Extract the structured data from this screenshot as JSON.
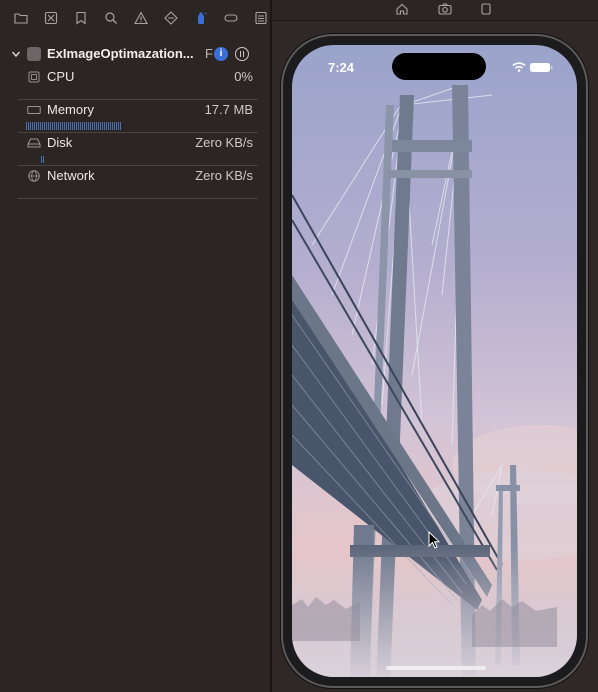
{
  "navigator": {
    "toolbar_icons": [
      "folder-icon",
      "x-square-icon",
      "bookmark-icon",
      "search-icon",
      "warning-icon",
      "diamond-icon",
      "spray-can-icon",
      "tag-icon",
      "list-icon"
    ]
  },
  "app": {
    "name": "ExImageOptimazation...",
    "suffix": "F",
    "info_glyph": "i"
  },
  "gauges": [
    {
      "label": "CPU",
      "value": "0%",
      "icon": "cpu-chip-icon"
    },
    {
      "label": "Memory",
      "value": "17.7 MB",
      "icon": "memory-icon"
    },
    {
      "label": "Disk",
      "value": "Zero KB/s",
      "icon": "disk-icon"
    },
    {
      "label": "Network",
      "value": "Zero KB/s",
      "icon": "globe-icon"
    }
  ],
  "simulator": {
    "toolbar_icons": [
      "home-icon",
      "camera-icon",
      "rotate-icon"
    ],
    "status_time": "7:24",
    "status_icons": [
      "wifi-icon",
      "battery-icon"
    ]
  },
  "colors": {
    "panel_bg": "#2b2523",
    "accent": "#3b6fd6",
    "graph": "#4b6fb3"
  }
}
